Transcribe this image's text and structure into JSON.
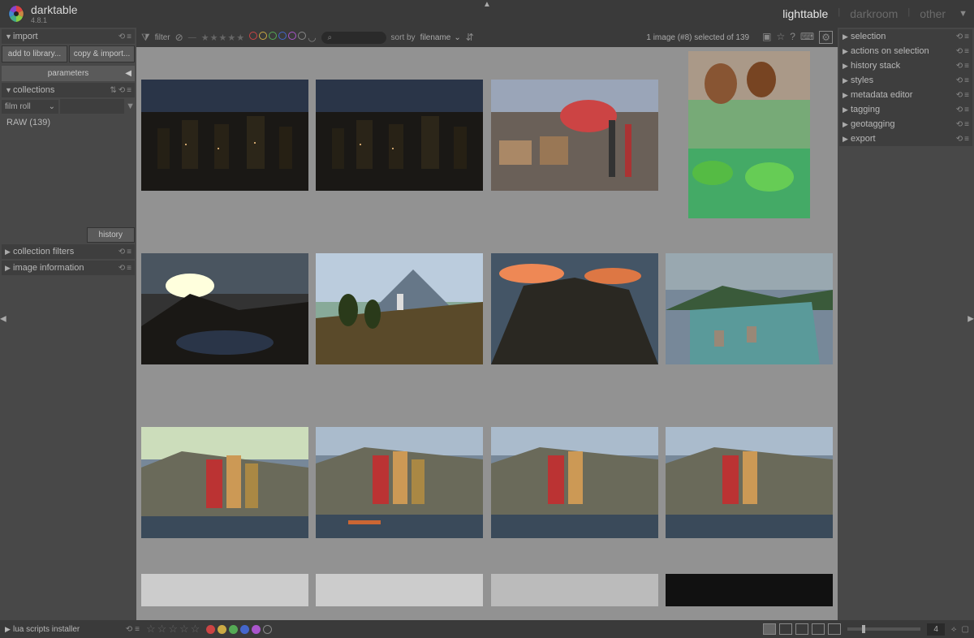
{
  "app": {
    "name": "darktable",
    "version": "4.8.1"
  },
  "views": {
    "lighttable": "lighttable",
    "darkroom": "darkroom",
    "other": "other"
  },
  "left_panel": {
    "import": {
      "label": "import",
      "add_to_library": "add to library...",
      "copy_import": "copy & import...",
      "parameters": "parameters"
    },
    "collections": {
      "label": "collections",
      "filter_type": "film roll",
      "item": "RAW (139)",
      "history_btn": "history"
    },
    "collection_filters": {
      "label": "collection filters"
    },
    "image_information": {
      "label": "image information"
    }
  },
  "toolbar": {
    "filter_label": "filter",
    "sortby_label": "sort by",
    "sort_value": "filename",
    "selection_text": "1 image (#8) selected of 139"
  },
  "right_panel": {
    "selection": "selection",
    "actions": "actions on selection",
    "history_stack": "history stack",
    "styles": "styles",
    "metadata": "metadata editor",
    "tagging": "tagging",
    "geotagging": "geotagging",
    "export": "export"
  },
  "bottom": {
    "lua": "lua scripts installer",
    "zoom_value": "4"
  },
  "colors": {
    "red": "#c44",
    "yellow": "#ca4",
    "green": "#5a5",
    "blue": "#46c",
    "purple": "#a5c"
  }
}
